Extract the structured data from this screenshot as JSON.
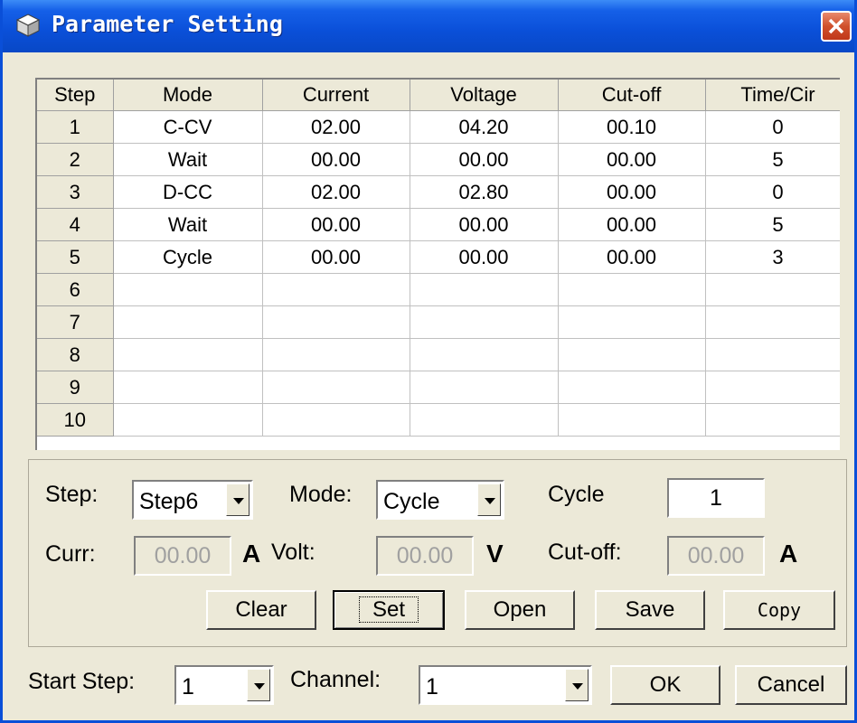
{
  "window": {
    "title": "Parameter Setting",
    "colors": {
      "titlebar": "#0a4fd8",
      "close": "#d0502c",
      "face": "#ece9d8"
    }
  },
  "grid": {
    "columns": [
      "Step",
      "Mode",
      "Current",
      "Voltage",
      "Cut-off",
      "Time/Cir"
    ],
    "rows": [
      [
        "1",
        "C-CV",
        "02.00",
        "04.20",
        "00.10",
        "0"
      ],
      [
        "2",
        "Wait",
        "00.00",
        "00.00",
        "00.00",
        "5"
      ],
      [
        "3",
        "D-CC",
        "02.00",
        "02.80",
        "00.00",
        "0"
      ],
      [
        "4",
        "Wait",
        "00.00",
        "00.00",
        "00.00",
        "5"
      ],
      [
        "5",
        "Cycle",
        "00.00",
        "00.00",
        "00.00",
        "3"
      ],
      [
        "6",
        "",
        "",
        "",
        "",
        ""
      ],
      [
        "7",
        "",
        "",
        "",
        "",
        ""
      ],
      [
        "8",
        "",
        "",
        "",
        "",
        ""
      ],
      [
        "9",
        "",
        "",
        "",
        "",
        ""
      ],
      [
        "10",
        "",
        "",
        "",
        "",
        ""
      ]
    ]
  },
  "editor": {
    "step_label": "Step:",
    "step_value": "Step6",
    "mode_label": "Mode:",
    "mode_value": "Cycle",
    "cycle_label": "Cycle",
    "cycle_value": "1",
    "curr_label": "Curr:",
    "curr_value": "00.00",
    "curr_unit": "A",
    "volt_label": "Volt:",
    "volt_value": "00.00",
    "volt_unit": "V",
    "cutoff_label": "Cut-off:",
    "cutoff_value": "00.00",
    "cutoff_unit": "A"
  },
  "buttons": {
    "clear": "Clear",
    "set": "Set",
    "open": "Open",
    "save": "Save",
    "copy": "Copy",
    "ok": "OK",
    "cancel": "Cancel"
  },
  "footer": {
    "start_step_label": "Start Step:",
    "start_step_value": "1",
    "channel_label": "Channel:",
    "channel_value": "1"
  }
}
